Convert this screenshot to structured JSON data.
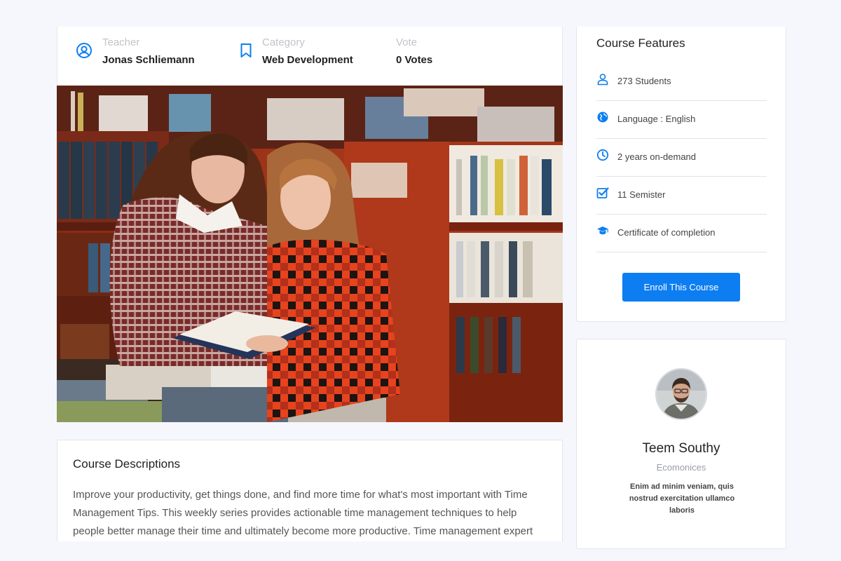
{
  "course_meta": {
    "teacher": {
      "label": "Teacher",
      "value": "Jonas Schliemann",
      "icon": "user-circle-icon"
    },
    "category": {
      "label": "Category",
      "value": "Web Development",
      "icon": "bookmark-icon"
    },
    "vote": {
      "label": "Vote",
      "value": "0 Votes"
    }
  },
  "hero_image": {
    "description": "two-students-reading-in-bookstore-photo"
  },
  "description": {
    "title": "Course Descriptions",
    "body": "Improve your productivity, get things done, and find more time for what's most important with Time Management Tips. This weekly series provides actionable time management techniques to help people better manage their time and ultimately become more productive. Time management expert"
  },
  "features": {
    "title": "Course Features",
    "items": [
      {
        "icon": "user-icon",
        "text": "273 Students"
      },
      {
        "icon": "globe-icon",
        "text": "Language : English"
      },
      {
        "icon": "clock-icon",
        "text": "2 years on-demand"
      },
      {
        "icon": "checkbox-icon",
        "text": "11 Semister"
      },
      {
        "icon": "graduation-cap-icon",
        "text": "Certificate of completion"
      }
    ],
    "enroll_label": "Enroll This Course"
  },
  "instructor": {
    "name": "Teem Southy",
    "role": "Ecomonices",
    "bio": "Enim ad minim veniam, quis nostrud exercitation ullamco laboris"
  },
  "colors": {
    "accent": "#0d7ef2",
    "background": "#f5f7fc",
    "card": "#ffffff"
  }
}
